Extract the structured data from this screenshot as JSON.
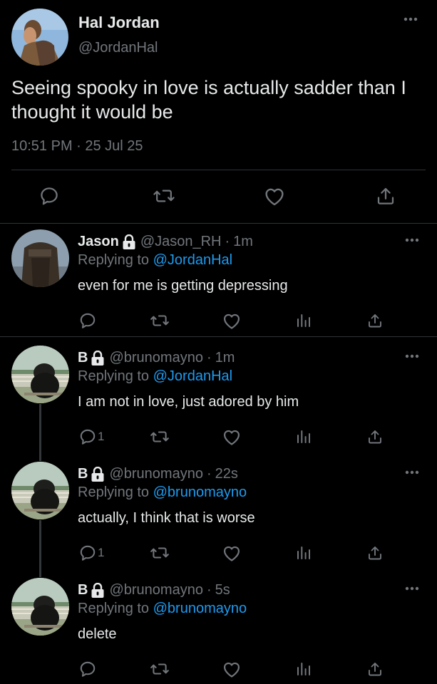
{
  "main_tweet": {
    "author_name": "Hal Jordan",
    "author_handle": "@JordanHal",
    "text": "Seeing spooky in love is actually sadder than I thought it would be",
    "timestamp": "10:51 PM · 25 Jul 25",
    "actions": [
      "reply-icon",
      "retweet-icon",
      "like-icon",
      "share-icon"
    ]
  },
  "replies": [
    {
      "name": "Jason",
      "handle": "@Jason_RH",
      "time": "1m",
      "replying_label": "Replying to",
      "replying_to": "@JordanHal",
      "text": "even for me is getting depressing",
      "reply_count": "",
      "protected": true
    },
    {
      "name": "B",
      "handle": "@brunomayno",
      "time": "1m",
      "replying_label": "Replying to",
      "replying_to": "@JordanHal",
      "text": "I am not in love, just adored by him",
      "reply_count": "1",
      "protected": true
    },
    {
      "name": "B",
      "handle": "@brunomayno",
      "time": "22s",
      "replying_label": "Replying to",
      "replying_to": "@brunomayno",
      "text": "actually, I think that is worse",
      "reply_count": "1",
      "protected": true
    },
    {
      "name": "B",
      "handle": "@brunomayno",
      "time": "5s",
      "replying_label": "Replying to",
      "replying_to": "@brunomayno",
      "text": "delete",
      "reply_count": "",
      "protected": true
    }
  ],
  "dot": "·",
  "colors": {
    "background": "#000000",
    "text": "#e7e9ea",
    "secondary": "#71767b",
    "link": "#1d9bf0",
    "divider": "#2f3336"
  }
}
